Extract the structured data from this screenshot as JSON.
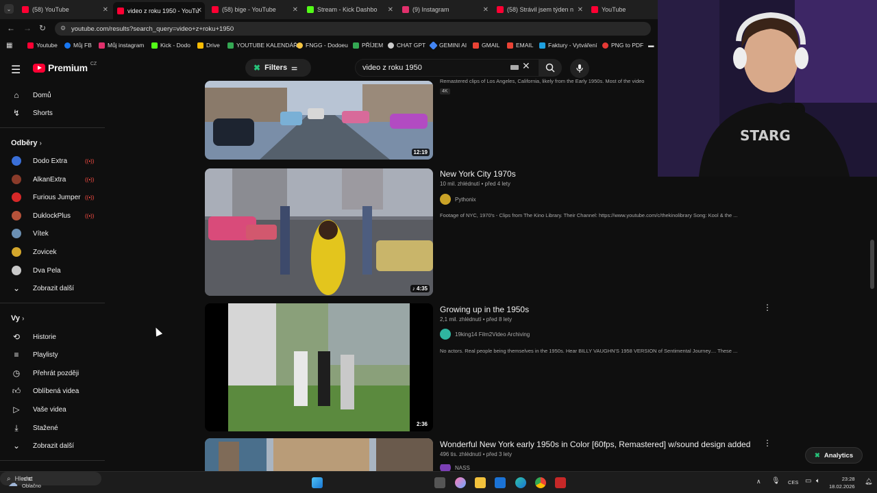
{
  "browser": {
    "tabs": [
      {
        "title": "(58) YouTube",
        "color": "#ff0033"
      },
      {
        "title": "video z roku 1950 - YouTu",
        "color": "#ff0033"
      },
      {
        "title": "(58) bige - YouTube",
        "color": "#ff0033"
      },
      {
        "title": "Stream - Kick Dashbo",
        "color": "#53fc18"
      },
      {
        "title": "(9) Instagram",
        "color": "#e1306c"
      },
      {
        "title": "(58) Strávil jsem týden n",
        "color": "#ff0033"
      },
      {
        "title": "YouTube",
        "color": "#ff0033"
      }
    ],
    "url": "youtube.com/results?search_query=video+z+roku+1950",
    "bookmarks": [
      {
        "label": "Youtube",
        "color": "#ff0033"
      },
      {
        "label": "Můj FB",
        "color": "#1877f2"
      },
      {
        "label": "Můj instagram",
        "color": "#e1306c"
      },
      {
        "label": "Kick - Dodo",
        "color": "#53fc18"
      },
      {
        "label": "Drive",
        "color": "#fbbc04"
      },
      {
        "label": "YOUTUBE KALENDÁŘ",
        "color": "#34a853"
      },
      {
        "label": "FNGG - Dodoeu",
        "color": "#f5c542"
      },
      {
        "label": "PŘÍJEM",
        "color": "#34a853"
      },
      {
        "label": "CHAT GPT",
        "color": "#cccccc"
      },
      {
        "label": "GEMINI AI",
        "color": "#4285f4"
      },
      {
        "label": "GMAIL",
        "color": "#ea4335"
      },
      {
        "label": "EMAIL",
        "color": "#ea4335"
      },
      {
        "label": "Faktury - Vytváření",
        "color": "#1ea0e0"
      },
      {
        "label": "PNG to PDF",
        "color": "#e53935"
      }
    ]
  },
  "header": {
    "logo_text": "Premium",
    "country": "CZ",
    "filters_label": "Filters",
    "search_value": "video z roku 1950"
  },
  "sidebar": {
    "home": "Domů",
    "shorts": "Shorts",
    "subs_heading": "Odběry",
    "subs": [
      {
        "name": "Dodo Extra",
        "color": "#3a6fd8",
        "live": true
      },
      {
        "name": "AlkanExtra",
        "color": "#8a3b2a",
        "live": true
      },
      {
        "name": "Furious Jumper",
        "color": "#d62828",
        "live": true
      },
      {
        "name": "DuklockPlus",
        "color": "#b5523a",
        "live": true
      },
      {
        "name": "Vítek",
        "color": "#6b8fb3",
        "live": false
      },
      {
        "name": "Zovicek",
        "color": "#d4a72c",
        "live": false
      },
      {
        "name": "Dva Pela",
        "color": "#c9c9c9",
        "live": false
      }
    ],
    "show_more_subs": "Zobrazit další",
    "you_heading": "Vy",
    "you_items": [
      "Historie",
      "Playlisty",
      "Přehrát později",
      "Oblíbená videa",
      "Vaše videa",
      "Stažené"
    ],
    "show_more_you": "Zobrazit další"
  },
  "results": {
    "top_desc": "Remastered clips of Los Angeles, California, likely from the Early 1950s. Most of the video",
    "top_badge": "4K",
    "top_duration": "12:19",
    "videos": [
      {
        "title": "New York City 1970s",
        "meta": "10 mil. zhlédnutí • před 4 lety",
        "channel": "Pythonix",
        "channel_color": "#c9a227",
        "desc": "Footage of NYC, 1970's - Clips from The Kino Library. Their Channel: https://www.youtube.com/c/thekinolibrary Song: Kool & the ...",
        "duration": "♪ 4:35"
      },
      {
        "title": "Growing up in the 1950s",
        "meta": "2,1 mil. zhlédnutí • před 8 lety",
        "channel": "19king14 Film2Video Archiving",
        "channel_color": "#2fb5a0",
        "desc": "No actors. Real people being themselves in the 1950s. Hear BILLY VAUGHN'S 1958 VERSION of Sentimental Journey.... These ...",
        "duration": "2:36"
      },
      {
        "title": "Wonderful New York early 1950s in Color [60fps, Remastered] w/sound design added",
        "meta": "496 tis. zhlédnutí • před 3 lety",
        "channel": "NASS",
        "channel_color": "#7b3fb5"
      }
    ]
  },
  "analytics_label": "Analytics",
  "taskbar": {
    "weather_temp": "-1°C",
    "weather_text": "Oblačno",
    "search_placeholder": "Hledat",
    "lang": "CES",
    "time": "23:28",
    "date": "18.02.2026"
  }
}
